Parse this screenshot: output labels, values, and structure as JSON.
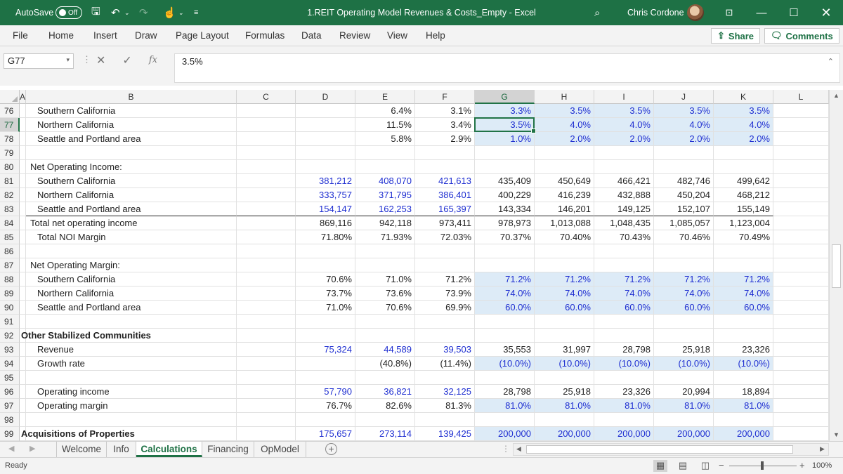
{
  "titlebar": {
    "autosave_label": "AutoSave",
    "autosave_state": "Off",
    "document_title": "1.REIT Operating Model Revenues & Costs_Empty  -  Excel",
    "user_name": "Chris Cordone"
  },
  "ribbon": {
    "tabs": [
      "File",
      "Home",
      "Insert",
      "Draw",
      "Page Layout",
      "Formulas",
      "Data",
      "Review",
      "View",
      "Help"
    ],
    "share_label": "Share",
    "comments_label": "Comments"
  },
  "formula_bar": {
    "name_box": "G77",
    "formula": "3.5%"
  },
  "columns": [
    "A",
    "B",
    "C",
    "D",
    "E",
    "F",
    "G",
    "H",
    "I",
    "J",
    "K",
    "L"
  ],
  "selected_column": "G",
  "selected_row": "77",
  "rows": [
    {
      "n": "76",
      "label": "Southern California",
      "values": [
        "",
        "6.4%",
        "3.1%",
        "3.3%",
        "3.5%",
        "3.5%",
        "3.5%",
        "3.5%"
      ]
    },
    {
      "n": "77",
      "label": "Northern California",
      "values": [
        "",
        "11.5%",
        "3.4%",
        "3.5%",
        "4.0%",
        "4.0%",
        "4.0%",
        "4.0%"
      ]
    },
    {
      "n": "78",
      "label": "Seattle and Portland area",
      "values": [
        "",
        "5.8%",
        "2.9%",
        "1.0%",
        "2.0%",
        "2.0%",
        "2.0%",
        "2.0%"
      ]
    },
    {
      "n": "79",
      "label": "",
      "values": [
        "",
        "",
        "",
        "",
        "",
        "",
        "",
        ""
      ]
    },
    {
      "n": "80",
      "label": "Net Operating Income:",
      "values": [
        "",
        "",
        "",
        "",
        "",
        "",
        "",
        ""
      ]
    },
    {
      "n": "81",
      "label": "Southern California",
      "values": [
        "381,212",
        "408,070",
        "421,613",
        "435,409",
        "450,649",
        "466,421",
        "482,746",
        "499,642"
      ]
    },
    {
      "n": "82",
      "label": "Northern California",
      "values": [
        "333,757",
        "371,795",
        "386,401",
        "400,229",
        "416,239",
        "432,888",
        "450,204",
        "468,212"
      ]
    },
    {
      "n": "83",
      "label": "Seattle and Portland area",
      "values": [
        "154,147",
        "162,253",
        "165,397",
        "143,334",
        "146,201",
        "149,125",
        "152,107",
        "155,149"
      ]
    },
    {
      "n": "84",
      "label": "Total net operating income",
      "values": [
        "869,116",
        "942,118",
        "973,411",
        "978,973",
        "1,013,088",
        "1,048,435",
        "1,085,057",
        "1,123,004"
      ]
    },
    {
      "n": "85",
      "label": "Total NOI Margin",
      "values": [
        "71.80%",
        "71.93%",
        "72.03%",
        "70.37%",
        "70.40%",
        "70.43%",
        "70.46%",
        "70.49%"
      ]
    },
    {
      "n": "86",
      "label": "",
      "values": [
        "",
        "",
        "",
        "",
        "",
        "",
        "",
        ""
      ]
    },
    {
      "n": "87",
      "label": "Net Operating Margin:",
      "values": [
        "",
        "",
        "",
        "",
        "",
        "",
        "",
        ""
      ]
    },
    {
      "n": "88",
      "label": "Southern California",
      "values": [
        "70.6%",
        "71.0%",
        "71.2%",
        "71.2%",
        "71.2%",
        "71.2%",
        "71.2%",
        "71.2%"
      ]
    },
    {
      "n": "89",
      "label": "Northern California",
      "values": [
        "73.7%",
        "73.6%",
        "73.9%",
        "74.0%",
        "74.0%",
        "74.0%",
        "74.0%",
        "74.0%"
      ]
    },
    {
      "n": "90",
      "label": "Seattle and Portland area",
      "values": [
        "71.0%",
        "70.6%",
        "69.9%",
        "60.0%",
        "60.0%",
        "60.0%",
        "60.0%",
        "60.0%"
      ]
    },
    {
      "n": "91",
      "label": "",
      "values": [
        "",
        "",
        "",
        "",
        "",
        "",
        "",
        ""
      ]
    },
    {
      "n": "92",
      "label": "Other Stabilized Communities",
      "values": [
        "",
        "",
        "",
        "",
        "",
        "",
        "",
        ""
      ]
    },
    {
      "n": "93",
      "label": "Revenue",
      "values": [
        "75,324",
        "44,589",
        "39,503",
        "35,553",
        "31,997",
        "28,798",
        "25,918",
        "23,326"
      ]
    },
    {
      "n": "94",
      "label": "Growth rate",
      "values": [
        "",
        "(40.8%)",
        "(11.4%)",
        "(10.0%)",
        "(10.0%)",
        "(10.0%)",
        "(10.0%)",
        "(10.0%)"
      ]
    },
    {
      "n": "95",
      "label": "",
      "values": [
        "",
        "",
        "",
        "",
        "",
        "",
        "",
        ""
      ]
    },
    {
      "n": "96",
      "label": "Operating income",
      "values": [
        "57,790",
        "36,821",
        "32,125",
        "28,798",
        "25,918",
        "23,326",
        "20,994",
        "18,894"
      ]
    },
    {
      "n": "97",
      "label": "Operating margin",
      "values": [
        "76.7%",
        "82.6%",
        "81.3%",
        "81.0%",
        "81.0%",
        "81.0%",
        "81.0%",
        "81.0%"
      ]
    },
    {
      "n": "98",
      "label": "",
      "values": [
        "",
        "",
        "",
        "",
        "",
        "",
        "",
        ""
      ]
    },
    {
      "n": "99",
      "label": "Acquisitions of Properties",
      "values": [
        "175,657",
        "273,114",
        "139,425",
        "200,000",
        "200,000",
        "200,000",
        "200,000",
        "200,000"
      ]
    }
  ],
  "sheet_tabs": [
    "Welcome",
    "Info",
    "Calculations",
    "Financing",
    "OpModel"
  ],
  "active_sheet": "Calculations",
  "status": {
    "text": "Ready",
    "zoom": "100%"
  }
}
